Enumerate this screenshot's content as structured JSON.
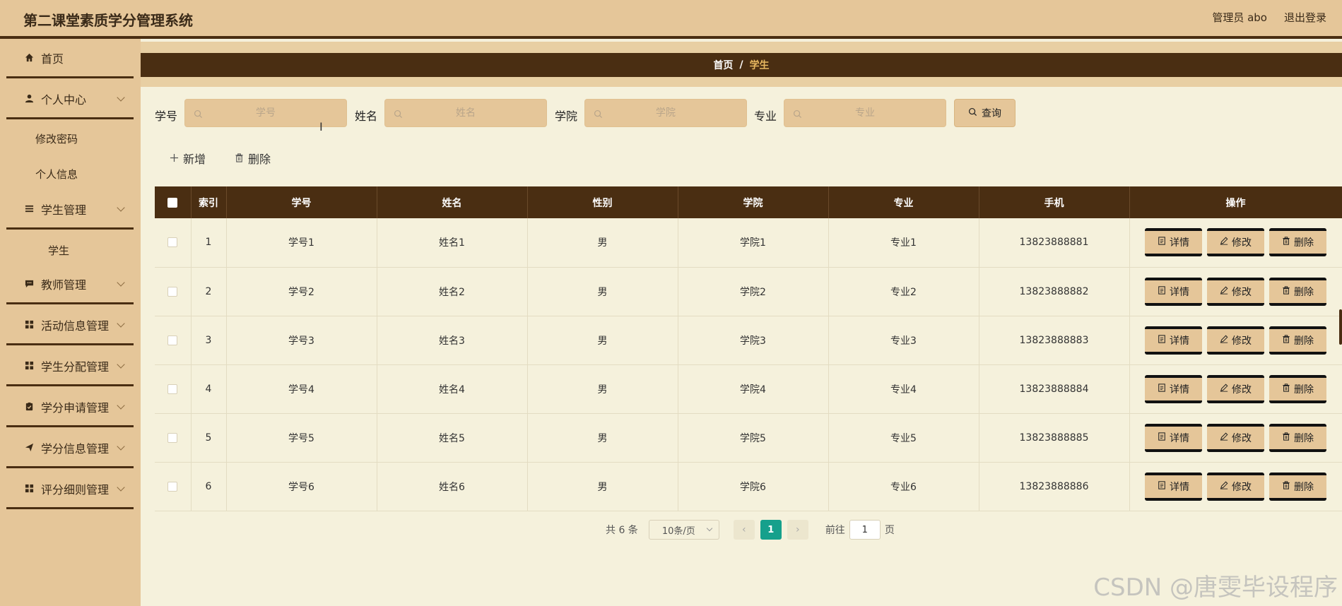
{
  "header": {
    "title": "第二课堂素质学分管理系统",
    "user": "管理员 abo",
    "logout": "退出登录"
  },
  "sidebar": {
    "home": "首页",
    "personal_center": "个人中心",
    "change_password": "修改密码",
    "personal_info": "个人信息",
    "student_mgmt": "学生管理",
    "student": "学生",
    "teacher_mgmt": "教师管理",
    "activity_mgmt": "活动信息管理",
    "student_assign_mgmt": "学生分配管理",
    "credit_apply_mgmt": "学分申请管理",
    "credit_info_mgmt": "学分信息管理",
    "scoring_rules_mgmt": "评分细则管理"
  },
  "breadcrumb": {
    "home": "首页",
    "sep": "/",
    "current": "学生"
  },
  "search": {
    "labels": [
      "学号",
      "姓名",
      "学院",
      "专业"
    ],
    "placeholders": [
      "学号",
      "姓名",
      "学院",
      "专业"
    ],
    "query_button": "查询"
  },
  "toolbar": {
    "add": "新增",
    "delete": "删除"
  },
  "table": {
    "headers": [
      "",
      "索引",
      "学号",
      "姓名",
      "性别",
      "学院",
      "专业",
      "手机",
      "操作"
    ],
    "rows": [
      [
        "1",
        "学号1",
        "姓名1",
        "男",
        "学院1",
        "专业1",
        "13823888881"
      ],
      [
        "2",
        "学号2",
        "姓名2",
        "男",
        "学院2",
        "专业2",
        "13823888882"
      ],
      [
        "3",
        "学号3",
        "姓名3",
        "男",
        "学院3",
        "专业3",
        "13823888883"
      ],
      [
        "4",
        "学号4",
        "姓名4",
        "男",
        "学院4",
        "专业4",
        "13823888884"
      ],
      [
        "5",
        "学号5",
        "姓名5",
        "男",
        "学院5",
        "专业5",
        "13823888885"
      ],
      [
        "6",
        "学号6",
        "姓名6",
        "男",
        "学院6",
        "专业6",
        "13823888886"
      ]
    ],
    "actions": [
      "详情",
      "修改",
      "删除"
    ]
  },
  "pagination": {
    "total": "共 6 条",
    "page_size": "10条/页",
    "current_page": "1",
    "goto_label": "前往",
    "goto_value": "1",
    "page_suffix": "页"
  },
  "watermark": "CSDN @唐雯毕设程序",
  "colors": {
    "header_bg": "#e5c699",
    "dark_brown": "#4a2e12",
    "page_bg": "#f5f1dc",
    "active_page": "#16a08c",
    "crumb_current": "#e8b860"
  }
}
